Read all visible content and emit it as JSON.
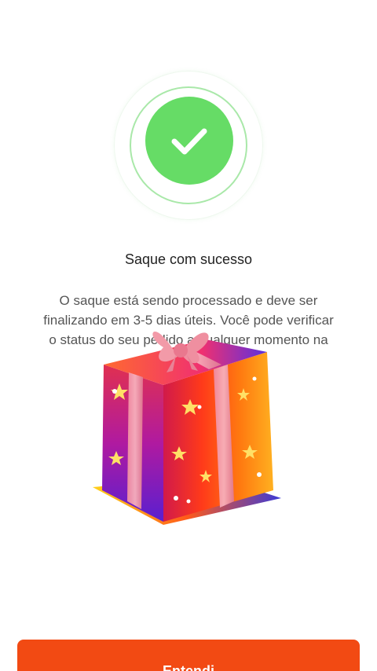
{
  "success_icon": {
    "icon": "check-icon",
    "color": "#66dc66",
    "ring_color": "#a9e8a9"
  },
  "title": "Saque com sucesso",
  "message": "O saque está sendo processado e deve ser finalizando em 3-5 dias úteis. Você pode verificar o status do seu pedido a qualquer momento na sua Carteira.",
  "overlay": {
    "icon": "gift-box-icon"
  },
  "button": {
    "label": "Entendi",
    "color": "#f24a13"
  }
}
